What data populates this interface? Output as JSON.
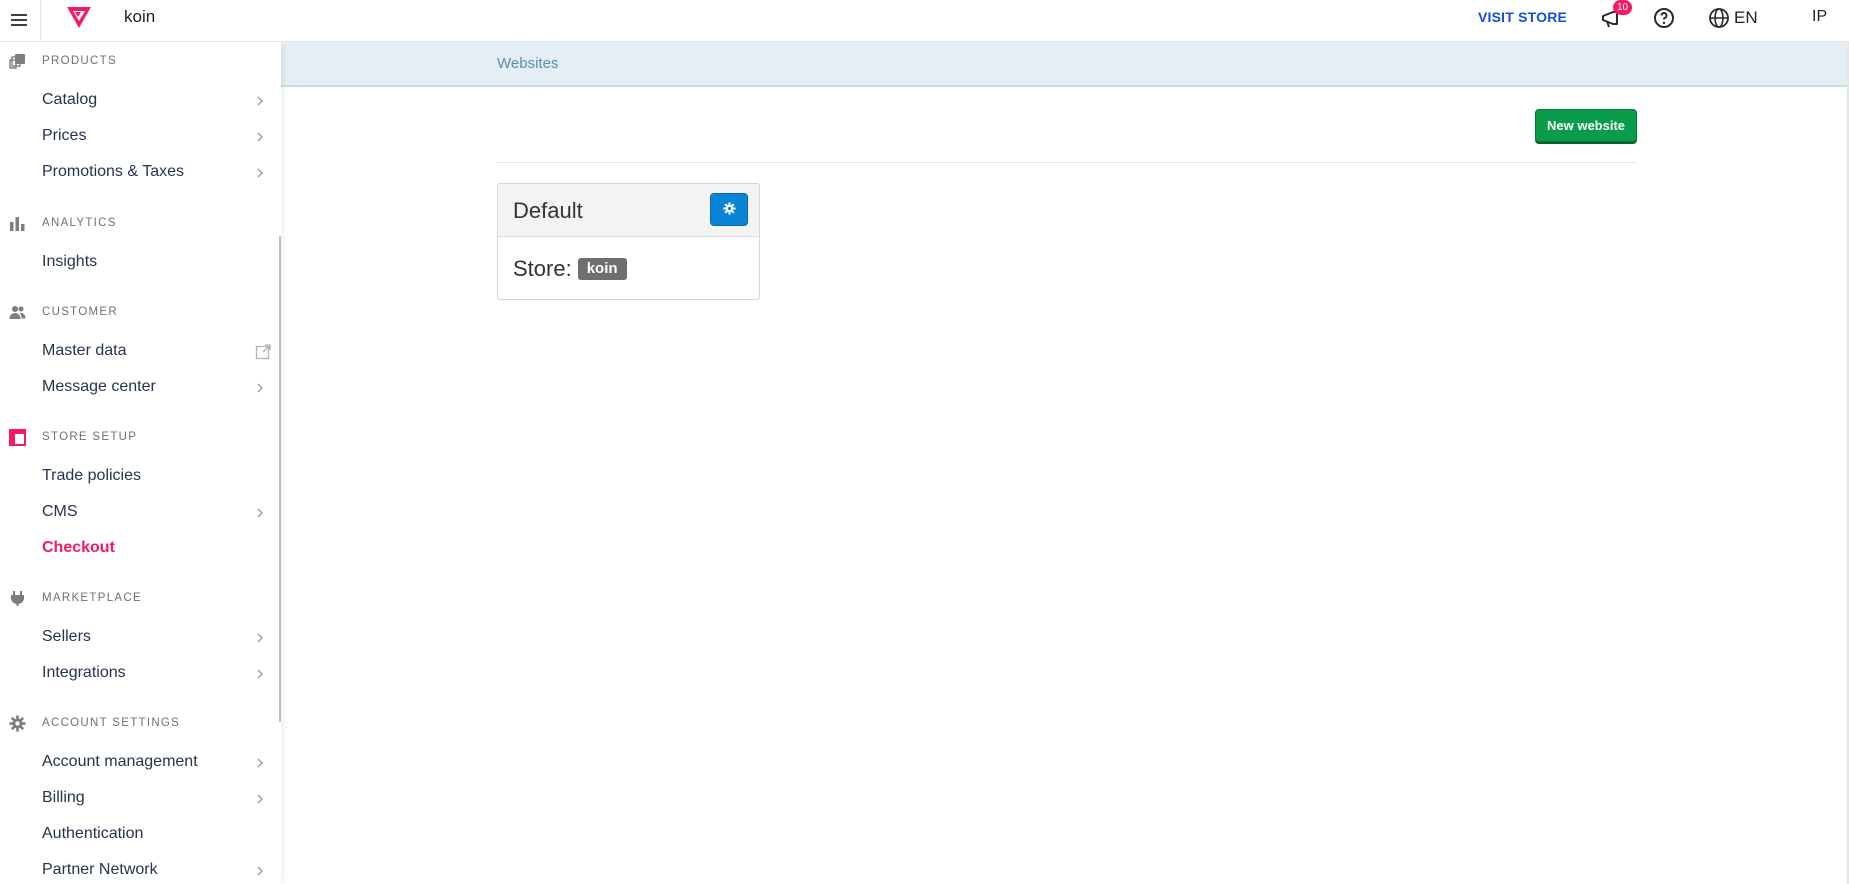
{
  "topbar": {
    "account_name": "koin",
    "visit_store": "VISIT STORE",
    "notification_count": "10",
    "language": "EN",
    "user_initials": "IP",
    "brand_color": "#f71963"
  },
  "sidebar": {
    "sections": [
      {
        "title": "PRODUCTS",
        "icon": "products-icon",
        "items": [
          {
            "label": "Catalog",
            "chevron": true
          },
          {
            "label": "Prices",
            "chevron": true
          },
          {
            "label": "Promotions & Taxes",
            "chevron": true
          }
        ]
      },
      {
        "title": "ANALYTICS",
        "icon": "bar-chart-icon",
        "items": [
          {
            "label": "Insights"
          }
        ]
      },
      {
        "title": "CUSTOMER",
        "icon": "users-icon",
        "items": [
          {
            "label": "Master data",
            "external": true
          },
          {
            "label": "Message center",
            "chevron": true
          }
        ]
      },
      {
        "title": "STORE SETUP",
        "icon": "store-setup-icon",
        "items": [
          {
            "label": "Trade policies"
          },
          {
            "label": "CMS",
            "chevron": true
          },
          {
            "label": "Checkout",
            "active": true
          }
        ]
      },
      {
        "title": "MARKETPLACE",
        "icon": "plug-icon",
        "items": [
          {
            "label": "Sellers",
            "chevron": true
          },
          {
            "label": "Integrations",
            "chevron": true
          }
        ]
      },
      {
        "title": "ACCOUNT SETTINGS",
        "icon": "gear-icon",
        "items": [
          {
            "label": "Account management",
            "chevron": true
          },
          {
            "label": "Billing",
            "chevron": true
          },
          {
            "label": "Authentication"
          },
          {
            "label": "Partner Network",
            "chevron": true
          }
        ]
      }
    ]
  },
  "main": {
    "breadcrumb": "Websites",
    "new_website_label": "New website",
    "card": {
      "title": "Default",
      "store_label": "Store:",
      "store_value": "koin"
    }
  }
}
